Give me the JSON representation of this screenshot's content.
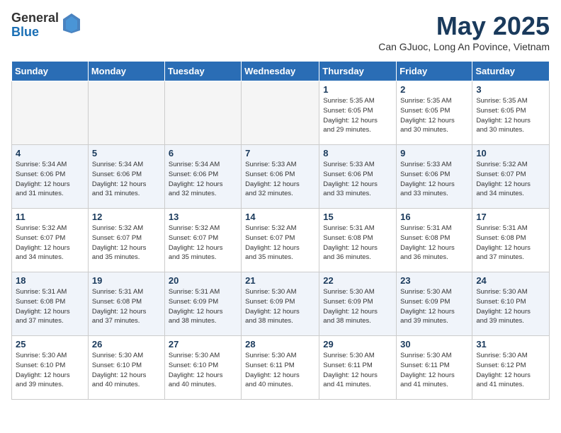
{
  "logo": {
    "general": "General",
    "blue": "Blue"
  },
  "header": {
    "month": "May 2025",
    "subtitle": "Can GJuoc, Long An Povince, Vietnam"
  },
  "weekdays": [
    "Sunday",
    "Monday",
    "Tuesday",
    "Wednesday",
    "Thursday",
    "Friday",
    "Saturday"
  ],
  "weeks": [
    [
      {
        "day": "",
        "info": ""
      },
      {
        "day": "",
        "info": ""
      },
      {
        "day": "",
        "info": ""
      },
      {
        "day": "",
        "info": ""
      },
      {
        "day": "1",
        "info": "Sunrise: 5:35 AM\nSunset: 6:05 PM\nDaylight: 12 hours\nand 29 minutes."
      },
      {
        "day": "2",
        "info": "Sunrise: 5:35 AM\nSunset: 6:05 PM\nDaylight: 12 hours\nand 30 minutes."
      },
      {
        "day": "3",
        "info": "Sunrise: 5:35 AM\nSunset: 6:05 PM\nDaylight: 12 hours\nand 30 minutes."
      }
    ],
    [
      {
        "day": "4",
        "info": "Sunrise: 5:34 AM\nSunset: 6:06 PM\nDaylight: 12 hours\nand 31 minutes."
      },
      {
        "day": "5",
        "info": "Sunrise: 5:34 AM\nSunset: 6:06 PM\nDaylight: 12 hours\nand 31 minutes."
      },
      {
        "day": "6",
        "info": "Sunrise: 5:34 AM\nSunset: 6:06 PM\nDaylight: 12 hours\nand 32 minutes."
      },
      {
        "day": "7",
        "info": "Sunrise: 5:33 AM\nSunset: 6:06 PM\nDaylight: 12 hours\nand 32 minutes."
      },
      {
        "day": "8",
        "info": "Sunrise: 5:33 AM\nSunset: 6:06 PM\nDaylight: 12 hours\nand 33 minutes."
      },
      {
        "day": "9",
        "info": "Sunrise: 5:33 AM\nSunset: 6:06 PM\nDaylight: 12 hours\nand 33 minutes."
      },
      {
        "day": "10",
        "info": "Sunrise: 5:32 AM\nSunset: 6:07 PM\nDaylight: 12 hours\nand 34 minutes."
      }
    ],
    [
      {
        "day": "11",
        "info": "Sunrise: 5:32 AM\nSunset: 6:07 PM\nDaylight: 12 hours\nand 34 minutes."
      },
      {
        "day": "12",
        "info": "Sunrise: 5:32 AM\nSunset: 6:07 PM\nDaylight: 12 hours\nand 35 minutes."
      },
      {
        "day": "13",
        "info": "Sunrise: 5:32 AM\nSunset: 6:07 PM\nDaylight: 12 hours\nand 35 minutes."
      },
      {
        "day": "14",
        "info": "Sunrise: 5:32 AM\nSunset: 6:07 PM\nDaylight: 12 hours\nand 35 minutes."
      },
      {
        "day": "15",
        "info": "Sunrise: 5:31 AM\nSunset: 6:08 PM\nDaylight: 12 hours\nand 36 minutes."
      },
      {
        "day": "16",
        "info": "Sunrise: 5:31 AM\nSunset: 6:08 PM\nDaylight: 12 hours\nand 36 minutes."
      },
      {
        "day": "17",
        "info": "Sunrise: 5:31 AM\nSunset: 6:08 PM\nDaylight: 12 hours\nand 37 minutes."
      }
    ],
    [
      {
        "day": "18",
        "info": "Sunrise: 5:31 AM\nSunset: 6:08 PM\nDaylight: 12 hours\nand 37 minutes."
      },
      {
        "day": "19",
        "info": "Sunrise: 5:31 AM\nSunset: 6:08 PM\nDaylight: 12 hours\nand 37 minutes."
      },
      {
        "day": "20",
        "info": "Sunrise: 5:31 AM\nSunset: 6:09 PM\nDaylight: 12 hours\nand 38 minutes."
      },
      {
        "day": "21",
        "info": "Sunrise: 5:30 AM\nSunset: 6:09 PM\nDaylight: 12 hours\nand 38 minutes."
      },
      {
        "day": "22",
        "info": "Sunrise: 5:30 AM\nSunset: 6:09 PM\nDaylight: 12 hours\nand 38 minutes."
      },
      {
        "day": "23",
        "info": "Sunrise: 5:30 AM\nSunset: 6:09 PM\nDaylight: 12 hours\nand 39 minutes."
      },
      {
        "day": "24",
        "info": "Sunrise: 5:30 AM\nSunset: 6:10 PM\nDaylight: 12 hours\nand 39 minutes."
      }
    ],
    [
      {
        "day": "25",
        "info": "Sunrise: 5:30 AM\nSunset: 6:10 PM\nDaylight: 12 hours\nand 39 minutes."
      },
      {
        "day": "26",
        "info": "Sunrise: 5:30 AM\nSunset: 6:10 PM\nDaylight: 12 hours\nand 40 minutes."
      },
      {
        "day": "27",
        "info": "Sunrise: 5:30 AM\nSunset: 6:10 PM\nDaylight: 12 hours\nand 40 minutes."
      },
      {
        "day": "28",
        "info": "Sunrise: 5:30 AM\nSunset: 6:11 PM\nDaylight: 12 hours\nand 40 minutes."
      },
      {
        "day": "29",
        "info": "Sunrise: 5:30 AM\nSunset: 6:11 PM\nDaylight: 12 hours\nand 41 minutes."
      },
      {
        "day": "30",
        "info": "Sunrise: 5:30 AM\nSunset: 6:11 PM\nDaylight: 12 hours\nand 41 minutes."
      },
      {
        "day": "31",
        "info": "Sunrise: 5:30 AM\nSunset: 6:12 PM\nDaylight: 12 hours\nand 41 minutes."
      }
    ]
  ]
}
